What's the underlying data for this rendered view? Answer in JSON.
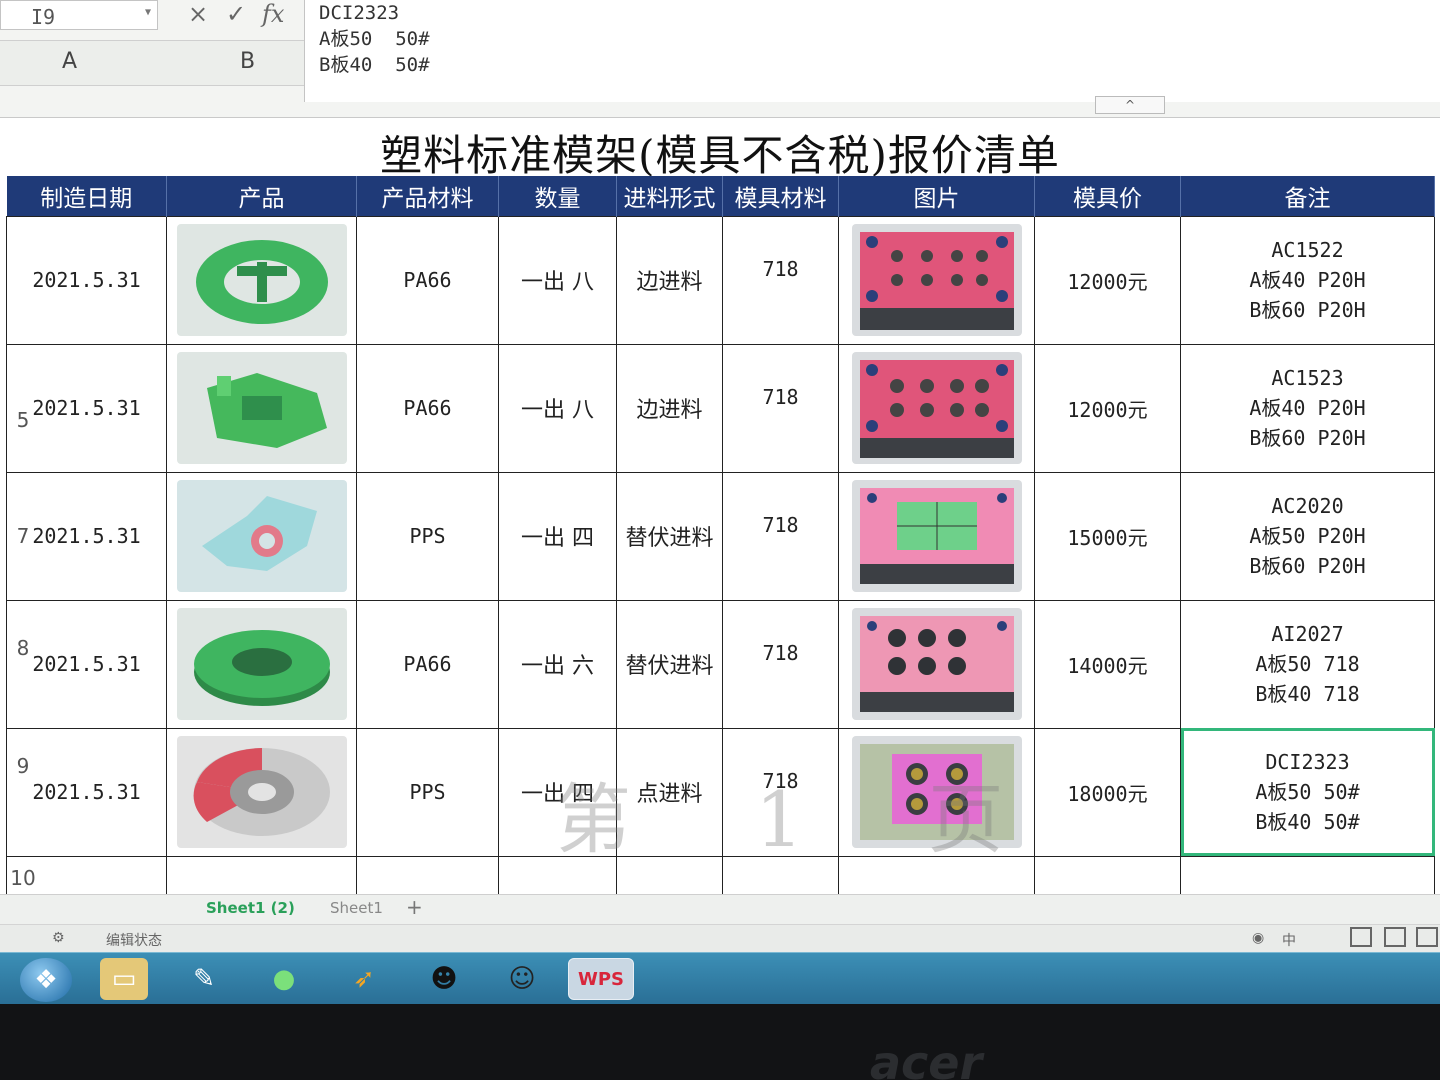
{
  "formula_bar": {
    "cell_ref": "I9",
    "cancel_symbol": "×",
    "confirm_symbol": "✓",
    "fx_symbol": "fx",
    "lines": [
      "DCI2323",
      "A板50  50#",
      "B板40  50#"
    ],
    "column_a": "A",
    "column_b": "B",
    "collapse_symbol": "^"
  },
  "sheet": {
    "title": "塑料标准模架(模具不含税)报价清单",
    "headers": [
      "制造日期",
      "产品",
      "产品材料",
      "数量",
      "进料形式",
      "模具材料",
      "图片",
      "模具价",
      "备注"
    ],
    "row_numbers": [
      "5",
      "7",
      "8",
      "9",
      "10"
    ],
    "rows": [
      {
        "date": "2021.5.31",
        "material": "PA66",
        "qty": "一出 八",
        "gate": "边进料",
        "mold_material": "718",
        "price": "12000元",
        "note": [
          "AC1522",
          "A板40  P20H",
          "B板60  P20H"
        ]
      },
      {
        "date": "2021.5.31",
        "material": "PA66",
        "qty": "一出 八",
        "gate": "边进料",
        "mold_material": "718",
        "price": "12000元",
        "note": [
          "AC1523",
          "A板40  P20H",
          "B板60  P20H"
        ]
      },
      {
        "date": "2021.5.31",
        "material": "PPS",
        "qty": "一出 四",
        "gate": "替伏进料",
        "mold_material": "718",
        "price": "15000元",
        "note": [
          "AC2020",
          "A板50  P20H",
          "B板60  P20H"
        ]
      },
      {
        "date": "2021.5.31",
        "material": "PA66",
        "qty": "一出 六",
        "gate": "替伏进料",
        "mold_material": "718",
        "price": "14000元",
        "note": [
          "AI2027",
          "A板50  718",
          "B板40  718"
        ]
      },
      {
        "date": "2021.5.31",
        "material": "PPS",
        "qty": "一出 四",
        "gate": "点进料",
        "mold_material": "718",
        "price": "18000元",
        "note": [
          "DCI2323",
          "A板50  50#",
          "B板40  50#"
        ]
      }
    ],
    "watermark": "第 1 页"
  },
  "tabs": {
    "active": "Sheet1 (2)",
    "other": "Sheet1",
    "add": "+"
  },
  "status": {
    "mode": "编辑状态",
    "input": "中"
  },
  "taskbar": {
    "app_label": "WPS"
  },
  "brand": "acer",
  "colors": {
    "header_bg": "#1f3a78",
    "selection": "#33b77b",
    "product_green": "#3fb560",
    "mold_pink": "#e0557a"
  }
}
